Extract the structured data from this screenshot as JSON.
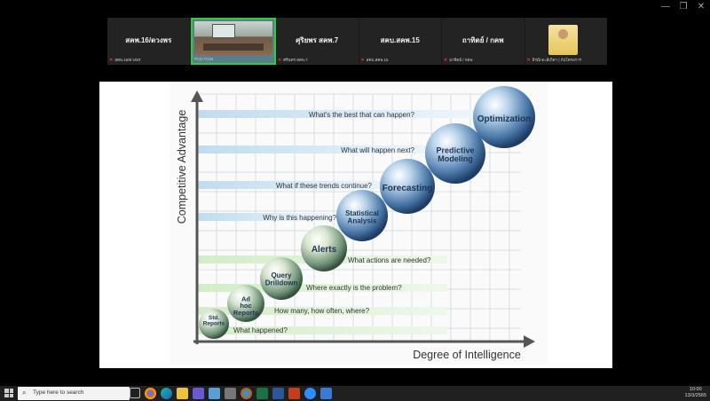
{
  "window": {
    "controls": [
      "—",
      "❐",
      "✕"
    ]
  },
  "participants": [
    {
      "name": "สคพ.16/ดวงพร",
      "label": "สคพ.16/ดวงพร",
      "muted": true
    },
    {
      "name": "",
      "label": "PCD-TC04",
      "muted": false,
      "active": true
    },
    {
      "name": "ศุริยพร สคพ.7",
      "label": "ศรีนทร สคพ.7",
      "muted": true
    },
    {
      "name": "สคบ.สคพ.15",
      "label": "สคบ.สคพ.15",
      "muted": true
    },
    {
      "name": "ถาทิตย์ / กคพ",
      "label": "อาทิตย์ / กคพ",
      "muted": true
    },
    {
      "name": "",
      "label": "ธิรณิ ตะลีเกิดา | กับโครงการ",
      "muted": true,
      "photo": true
    }
  ],
  "chart": {
    "y_axis_label": "Competitive Advantage",
    "x_axis_label": "Degree of Intelligence",
    "levels": [
      {
        "sphere": "Std. Reports",
        "question": "What happened?"
      },
      {
        "sphere": "Ad hoc Reports",
        "question": "How many, how often, where?"
      },
      {
        "sphere": "Query Drilldown",
        "question": "Where exactly is the problem?"
      },
      {
        "sphere": "Alerts",
        "question": "What actions are needed?"
      },
      {
        "sphere": "Statistical Analysis",
        "question": "Why is this happening?"
      },
      {
        "sphere": "Forecasting",
        "question": "What if these trends continue?"
      },
      {
        "sphere": "Predictive Modeling",
        "question": "What will happen next?"
      },
      {
        "sphere": "Optimization",
        "question": "What's the best that can happen?"
      }
    ]
  },
  "taskbar": {
    "search_placeholder": "Type here to search",
    "time": "10:00",
    "date": "13/3/2565"
  }
}
